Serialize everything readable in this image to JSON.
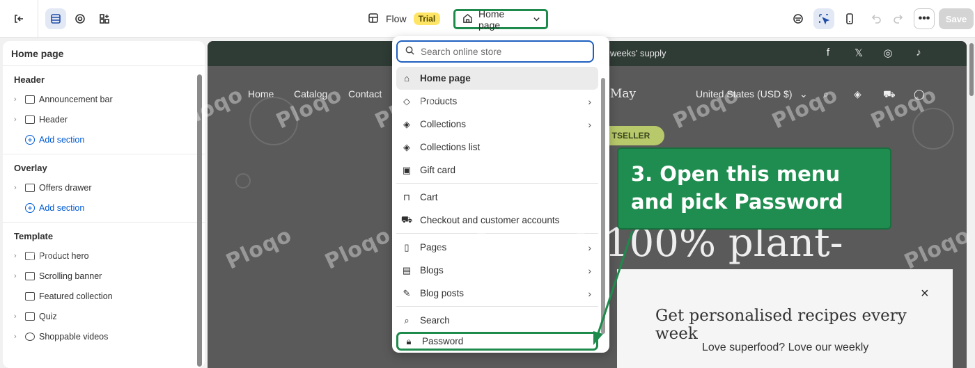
{
  "topbar": {
    "flow_label": "Flow",
    "trial_badge": "Trial",
    "page_selector": "Home page",
    "save_label": "Save",
    "more_label": "•••"
  },
  "sidebar": {
    "title": "Home page",
    "groups": [
      {
        "heading": "Header",
        "items": [
          "Announcement bar",
          "Header"
        ],
        "add_label": "Add section"
      },
      {
        "heading": "Overlay",
        "items": [
          "Offers drawer"
        ],
        "add_label": "Add section"
      },
      {
        "heading": "Template",
        "items": [
          "Product hero",
          "Scrolling banner",
          "Featured collection",
          "Quiz",
          "Shoppable videos"
        ]
      }
    ]
  },
  "preview": {
    "announcement": "weeks' supply",
    "nav": [
      "Home",
      "Catalog",
      "Contact"
    ],
    "logo_text": "May",
    "currency": "United States (USD $)",
    "badge": "TSELLER",
    "hero_text": "100% plant-",
    "popup_title": "Get personalised recipes every week",
    "popup_sub": "Love superfood? Love our weekly",
    "popup_close": "×"
  },
  "dropdown": {
    "search_placeholder": "Search online store",
    "items": [
      {
        "label": "Home page",
        "icon": "home-icon",
        "arrow": false
      },
      {
        "label": "Products",
        "icon": "tag-icon",
        "arrow": true
      },
      {
        "label": "Collections",
        "icon": "collection-icon",
        "arrow": true
      },
      {
        "label": "Collections list",
        "icon": "collections-list-icon",
        "arrow": false
      },
      {
        "label": "Gift card",
        "icon": "gift-card-icon",
        "arrow": false
      },
      {
        "label": "Cart",
        "icon": "bag-icon",
        "arrow": false
      },
      {
        "label": "Checkout and customer accounts",
        "icon": "cart-icon",
        "arrow": false
      },
      {
        "label": "Pages",
        "icon": "page-icon",
        "arrow": true
      },
      {
        "label": "Blogs",
        "icon": "blog-icon",
        "arrow": true
      },
      {
        "label": "Blog posts",
        "icon": "edit-icon",
        "arrow": true
      },
      {
        "label": "Search",
        "icon": "search-icon",
        "arrow": false
      },
      {
        "label": "Password",
        "icon": "lock-icon",
        "arrow": false
      }
    ]
  },
  "callout": {
    "line1": "3. Open this menu",
    "line2": "and pick Password"
  },
  "watermark": "Ploqo",
  "colors": {
    "callout_bg": "#1f8d4f",
    "highlight_border": "#1e8a4c",
    "trial_badge": "#ffe566",
    "link_blue": "#005bd3"
  }
}
